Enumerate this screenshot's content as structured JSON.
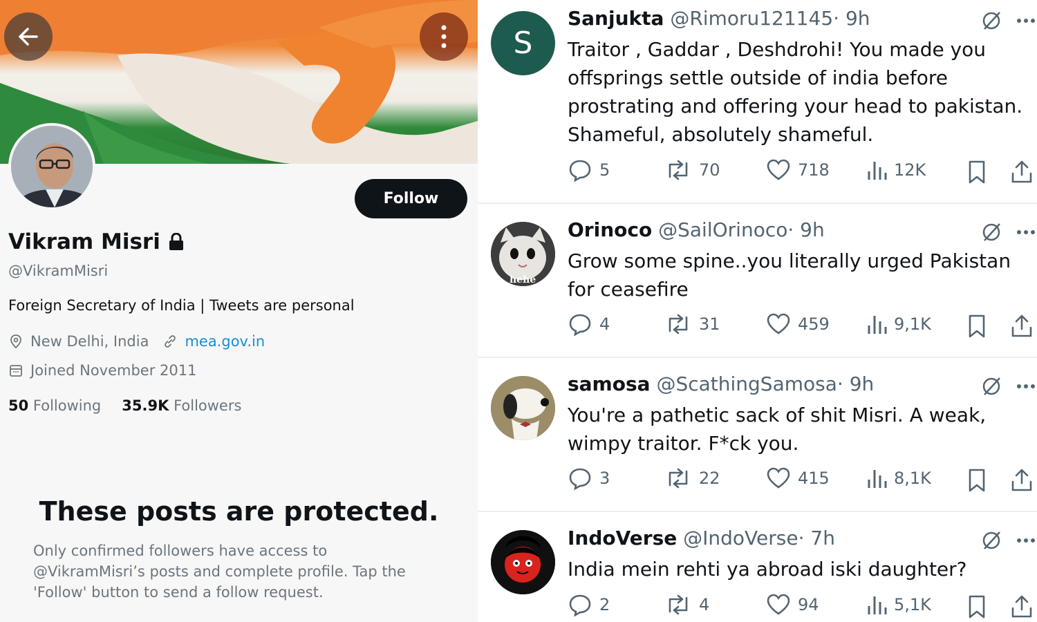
{
  "profile": {
    "name": "Vikram Misri",
    "handle": "@VikramMisri",
    "bio": "Foreign Secretary of India | Tweets are personal",
    "location": "New Delhi, India",
    "website": "mea.gov.in",
    "joined": "Joined November 2011",
    "following_count": "50",
    "following_label": "Following",
    "followers_count": "35.9K",
    "followers_label": "Followers",
    "follow_label": "Follow",
    "protected_title": "These posts are protected.",
    "protected_text": "Only confirmed followers have access to @VikramMisri’s posts and complete profile. Tap the 'Follow' button to send a follow request."
  },
  "replies": [
    {
      "name": "Sanjukta",
      "handle": "@Rimoru121145",
      "time": "· 9h",
      "avatar_letter": "S",
      "text": "Traitor , Gaddar , Deshdrohi! You made you offsprings settle outside of india before prostrating and offering your head to pakistan. Shameful, absolutely shameful.",
      "replies": "5",
      "reposts": "70",
      "likes": "718",
      "views": "12K"
    },
    {
      "name": "Orinoco",
      "handle": "@SailOrinoco",
      "time": "· 9h",
      "avatar_caption": "hehe",
      "text": "Grow some spine..you literally urged Pakistan for ceasefire",
      "replies": "4",
      "reposts": "31",
      "likes": "459",
      "views": "9,1K"
    },
    {
      "name": "samosa",
      "handle": "@ScathingSamosa",
      "time": "· 9h",
      "text": "You're a pathetic sack of shit Misri. A weak, wimpy traitor. F*ck you.",
      "replies": "3",
      "reposts": "22",
      "likes": "415",
      "views": "8,1K"
    },
    {
      "name": "IndoVerse",
      "handle": "@IndoVerse",
      "time": "· 7h",
      "text": "India mein rehti ya abroad iski daughter?",
      "replies": "2",
      "reposts": "4",
      "likes": "94",
      "views": "5,1K"
    }
  ],
  "colors": {
    "link": "#1a8cd8",
    "secondary_text": "#536471",
    "follow_bg": "#0f1419",
    "avatar_s_bg": "#1e5b4f"
  }
}
